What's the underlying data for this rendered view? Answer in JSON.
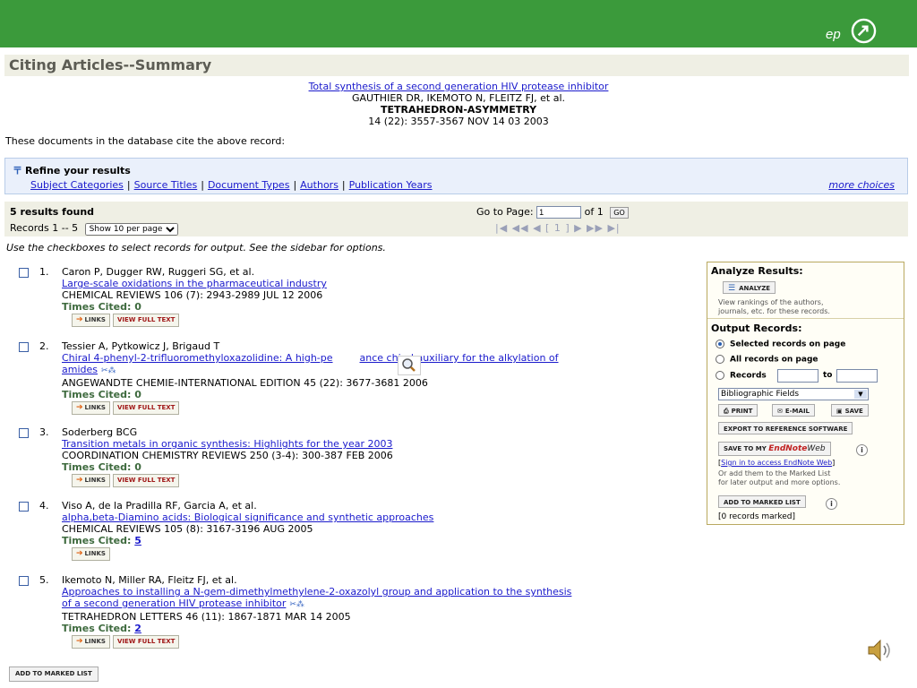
{
  "header": {
    "logo_text": "ep",
    "brand_color": "#3b9a3b"
  },
  "page_title": "Citing Articles--Summary",
  "cited_record": {
    "title": "Total synthesis of a second generation HIV protease inhibitor",
    "authors": "GAUTHIER DR, IKEMOTO N, FLEITZ FJ, et al.",
    "journal": "TETRAHEDRON-ASYMMETRY",
    "citation": "14 (22): 3557-3567 NOV 14 03 2003"
  },
  "intro_text": "These documents in the database cite the above record:",
  "refine": {
    "heading": "Refine your results",
    "categories": [
      "Subject Categories",
      "Source Titles",
      "Document Types",
      "Authors",
      "Publication Years"
    ],
    "separator": "|",
    "more": "more choices"
  },
  "results": {
    "found": "5 results found",
    "records_range": "Records 1 -- 5",
    "per_page_option": "Show 10 per page",
    "goto_label": "Go to Page:",
    "goto_value": "1",
    "of_label": "of 1",
    "go_button": "GO",
    "pager": "|◀ ◀◀ ◀ [ 1 ] ▶ ▶▶ ▶|"
  },
  "hint": "Use the checkboxes to select records for output. See the sidebar for options.",
  "labels": {
    "times_cited": "Times Cited:",
    "links": "LINKS",
    "view_full_text": "VIEW FULL TEXT",
    "add_to_marked": "ADD TO MARKED LIST"
  },
  "items": [
    {
      "num": "1.",
      "authors": "Caron P, Dugger RW, Ruggeri SG, et al.",
      "title_lines": [
        "Large-scale oxidations in the pharmaceutical industry"
      ],
      "source": "CHEMICAL REVIEWS 106 (7): 2943-2989 JUL 12 2006",
      "times_cited": "0"
    },
    {
      "num": "2.",
      "authors": "Tessier A, Pytkowicz J, Brigaud T",
      "title_lines": [
        "Chiral 4-phenyl-2-trifluoromethyloxazolidine: A high-pe",
        "ance chiral auxiliary for the alkylation of",
        "amides"
      ],
      "source": "ANGEWANDTE CHEMIE-INTERNATIONAL EDITION 45 (22): 3677-3681 2006",
      "times_cited": "0"
    },
    {
      "num": "3.",
      "authors": "Soderberg BCG",
      "title_lines": [
        "Transition metals in organic synthesis: Highlights for the year 2003"
      ],
      "source": "COORDINATION CHEMISTRY REVIEWS 250 (3-4): 300-387 FEB 2006",
      "times_cited": "0"
    },
    {
      "num": "4.",
      "authors": "Viso A, de la Pradilla RF, Garcia A, et al.",
      "title_lines": [
        "alpha,beta-Diamino acids: Biological significance and synthetic approaches"
      ],
      "source": "CHEMICAL REVIEWS 105 (8): 3167-3196 AUG 2005",
      "times_cited": "5"
    },
    {
      "num": "5.",
      "authors": "Ikemoto N, Miller RA, Fleitz FJ, et al.",
      "title_lines": [
        "Approaches to installing a N-gem-dimethylmethylene-2-oxazolyl group and application to the synthesis",
        "of a second generation HIV protease inhibitor"
      ],
      "source": "TETRAHEDRON LETTERS 46 (11): 1867-1871 MAR 14 2005",
      "times_cited": "2"
    }
  ],
  "sidebar": {
    "analyze_heading": "Analyze Results:",
    "analyze_button": "ANALYZE",
    "analyze_desc_1": "View rankings of the authors,",
    "analyze_desc_2": "journals, etc. for these records.",
    "output_heading": "Output Records:",
    "opt_selected": "Selected records on page",
    "opt_all": "All records on page",
    "opt_records": "Records",
    "to_label": "to",
    "fields_select": "Bibliographic Fields",
    "print": "PRINT",
    "email": "E-MAIL",
    "save": "SAVE",
    "export": "EXPORT TO REFERENCE SOFTWARE",
    "save_to_my": "SAVE TO MY",
    "endnote": "EndNote",
    "endnote_web": "Web",
    "sign_in": "Sign in to access EndNote Web",
    "or_add_1": "Or add them to the Marked List",
    "or_add_2": "for later output and more options.",
    "add_marked": "ADD TO MARKED LIST",
    "records_marked": "[0 records marked]"
  }
}
